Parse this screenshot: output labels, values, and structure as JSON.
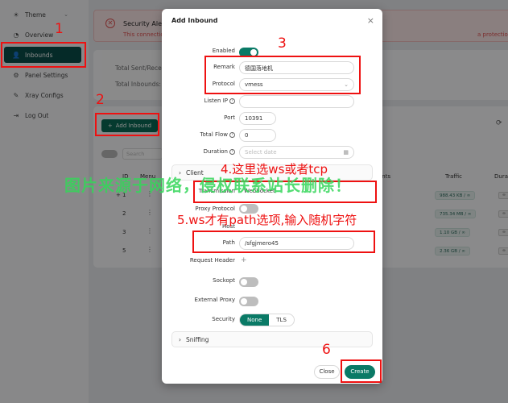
{
  "sidebar": {
    "items": [
      {
        "label": "Theme",
        "icon": "bulb-icon"
      },
      {
        "label": "Overview",
        "icon": "dashboard-icon"
      },
      {
        "label": "Inbounds",
        "icon": "user-icon"
      },
      {
        "label": "Panel Settings",
        "icon": "gear-icon"
      },
      {
        "label": "Xray Configs",
        "icon": "tool-icon"
      },
      {
        "label": "Log Out",
        "icon": "logout-icon"
      }
    ]
  },
  "alert": {
    "title": "Security Alert",
    "text": "This connection",
    "text_right": "a protection."
  },
  "stats": {
    "total_sent": "Total Sent/Receive",
    "total_inbounds": "Total Inbounds:"
  },
  "inbounds": {
    "add_button": "Add Inbound",
    "search_placeholder": "Search",
    "columns": [
      "ID",
      "Menu",
      "ents",
      "Traffic",
      "Dura"
    ],
    "rows": [
      {
        "id": "1",
        "expand": "+",
        "traffic": "988.43 KB / ∞"
      },
      {
        "id": "2",
        "traffic": "735.34 MB / ∞"
      },
      {
        "id": "3",
        "traffic": "1.10 GB / ∞"
      },
      {
        "id": "5",
        "traffic": "2.36 GB / ∞"
      }
    ],
    "dura": "∞"
  },
  "modal": {
    "title": "Add Inbound",
    "enabled_label": "Enabled",
    "enabled": true,
    "remark_label": "Remark",
    "remark_value": "德国落地机",
    "protocol_label": "Protocol",
    "protocol_value": "vmess",
    "listen_ip_label": "Listen IP",
    "listen_ip_value": "",
    "port_label": "Port",
    "port_value": "10391",
    "total_flow_label": "Total Flow",
    "total_flow_value": "0",
    "duration_label": "Duration",
    "duration_placeholder": "Select date",
    "client_label": "Client",
    "transmission_label": "Transmission",
    "transmission_value": "WebSocket",
    "proxy_protocol_label": "Proxy Protocol",
    "host_label": "Host",
    "path_label": "Path",
    "path_value": "/sfgjmero45",
    "request_header_label": "Request Header",
    "sockopt_label": "Sockopt",
    "external_proxy_label": "External Proxy",
    "security_label": "Security",
    "security_options": [
      "None",
      "TLS"
    ],
    "security_selected": "None",
    "sniffing_label": "Sniffing",
    "close_button": "Close",
    "create_button": "Create"
  },
  "annotations": {
    "n1": "1",
    "n2": "2",
    "n3": "3",
    "n4": "4.这里选ws或者tcp",
    "n5": "5.ws才有path选项,输入随机字符",
    "n6": "6",
    "watermark": "图片来源于网络，侵权联系站长删除！"
  },
  "colors": {
    "accent": "#0a7a66",
    "sidebar_active": "#0a4d4a",
    "annotation": "#ee1111",
    "watermark": "#35d65a"
  }
}
